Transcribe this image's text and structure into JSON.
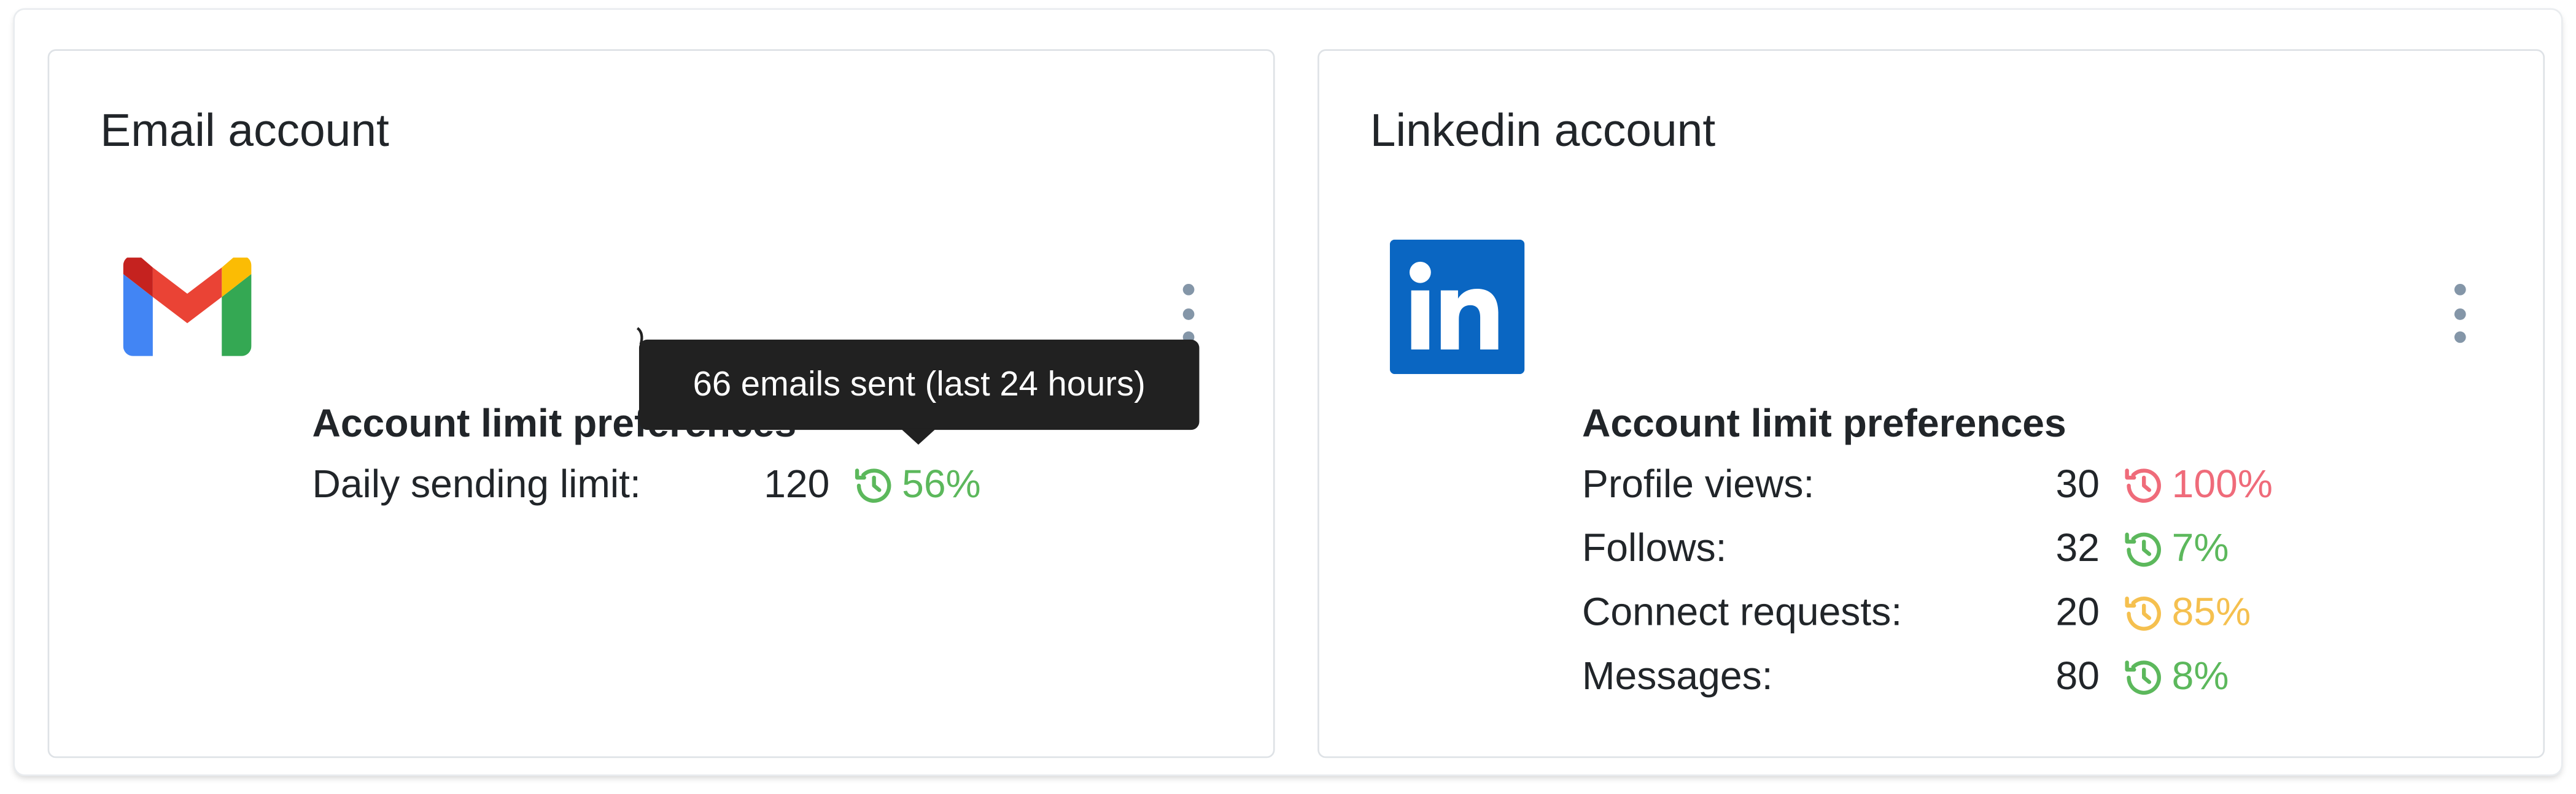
{
  "email_card": {
    "title": "Email account",
    "logo_icon": "gmail-icon",
    "limits_title": "Account limit preferences",
    "rows": [
      {
        "label": "Daily sending limit:",
        "value": "120",
        "percent": "56%",
        "color": "#5cb85c",
        "icon": "history-icon"
      }
    ],
    "tooltip": "66 emails sent (last 24 hours)"
  },
  "linkedin_card": {
    "title": "Linkedin account",
    "logo_icon": "linkedin-icon",
    "limits_title": "Account limit preferences",
    "rows": [
      {
        "label": "Profile views:",
        "value": "30",
        "percent": "100%",
        "color": "#ef6b7a",
        "icon": "history-icon"
      },
      {
        "label": "Follows:",
        "value": "32",
        "percent": "7%",
        "color": "#5cb85c",
        "icon": "history-icon"
      },
      {
        "label": "Connect requests:",
        "value": "20",
        "percent": "85%",
        "color": "#f5c04f",
        "icon": "history-icon"
      },
      {
        "label": "Messages:",
        "value": "80",
        "percent": "8%",
        "color": "#5cb85c",
        "icon": "history-icon"
      }
    ]
  },
  "colors": {
    "kebab": "#8496a8",
    "linkedin_blue": "#0a66c2",
    "tooltip_bg": "#212121"
  }
}
